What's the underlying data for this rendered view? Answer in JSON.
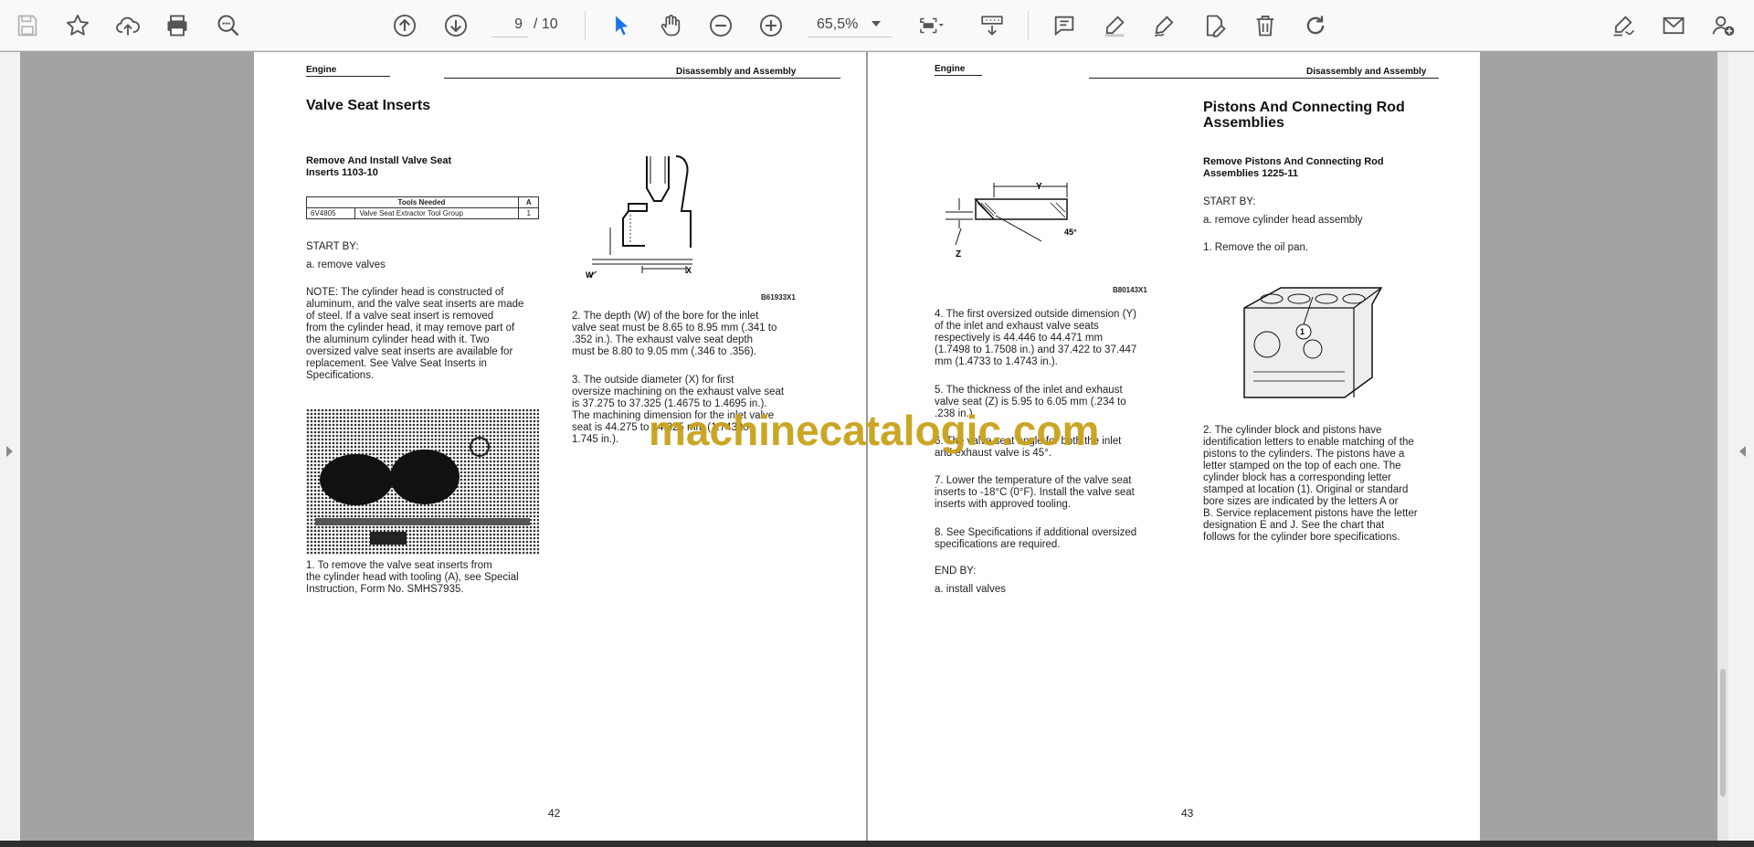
{
  "toolbar": {
    "current_page": "9",
    "total_pages": "/ 10",
    "zoom": "65,5%",
    "icons": [
      "save-icon",
      "bookmark-star-icon",
      "upload-cloud-icon",
      "print-icon",
      "zoom-search-icon",
      "page-up-icon",
      "page-down-icon",
      "select-cursor-icon",
      "hand-pan-icon",
      "zoom-out-icon",
      "zoom-in-icon",
      "fit-page-icon",
      "scroll-mode-icon",
      "comment-icon",
      "highlight-pen-icon",
      "draw-pen-icon",
      "edit-text-icon",
      "trash-icon",
      "rotate-icon",
      "sign-icon",
      "email-icon",
      "share-user-icon"
    ]
  },
  "page42": {
    "header_left": "Engine",
    "header_right": "Disassembly and Assembly",
    "title": "Valve Seat Inserts",
    "subtitle": "Remove And Install Valve Seat\nInserts     1103-10",
    "table": {
      "header": "Tools Needed",
      "col_a": "A",
      "part": "6V4805",
      "desc": "Valve Seat Extractor Tool Group",
      "qty": "1"
    },
    "start_by": "START BY:",
    "start_a": "a.  remove valves",
    "note": "NOTE:  The cylinder head is constructed of\naluminum, and the valve seat inserts are made\nof steel. If a valve seat insert is removed\nfrom the cylinder head, it may remove part of\nthe aluminum cylinder head with it. Two\noversized valve seat inserts are available for\nreplacement. See Valve Seat Inserts in\nSpecifications.",
    "step1": "1.  To remove the valve seat inserts from\nthe cylinder head with tooling (A), see Special\nInstruction, Form No. SMHS7935.",
    "fig_caption": "B61933X1",
    "step2": "2.  The depth (W) of the bore for the inlet\nvalve seat must be 8.65 to 8.95 mm (.341 to\n.352 in.). The exhaust valve seat depth\nmust be 8.80 to 9.05 mm (.346 to .356).",
    "step3": "3.  The outside diameter (X) for first\noversize machining on the exhaust valve seat\nis 37.275 to 37.325 (1.4675 to 1.4695 in.).\nThe machining dimension for the inlet valve\nseat is 44.275 to 44.325 mm (1.743 to\n1.745 in.).",
    "label_w": "W",
    "label_x": "X",
    "page_number": "42"
  },
  "page43": {
    "header_left": "Engine",
    "header_right": "Disassembly and Assembly",
    "fig_caption": "B80143X1",
    "label_y": "Y",
    "label_z": "Z",
    "label_angle": "45°",
    "step4": "4.  The first oversized outside dimension (Y)\nof the inlet and exhaust valve seats\nrespectively is 44.446 to 44.471 mm\n(1.7498 to 1.7508 in.) and 37.422 to 37.447\nmm (1.4733 to 1.4743 in.).",
    "step5": "5.  The thickness of the inlet and exhaust\nvalve seat (Z) is 5.95 to 6.05 mm (.234 to\n.238 in.).",
    "step6": "6.  The valve seat angle for both the inlet\nand exhaust valve is 45°.",
    "step7": "7.  Lower the temperature of the valve seat\ninserts to -18°C (0°F). Install the valve seat\ninserts with approved tooling.",
    "step8": "8.  See Specifications if additional oversized\nspecifications are required.",
    "end_by": "END BY:",
    "end_a": "a.  install valves",
    "title": "Pistons And Connecting Rod\nAssemblies",
    "subtitle": "Remove Pistons And Connecting Rod\nAssemblies     1225-11",
    "start_by": "START BY:",
    "start_a": "a.  remove cylinder head assembly",
    "r_step1": "1.  Remove the oil pan.",
    "block_label": "1",
    "r_step2": "2.  The cylinder block and pistons have\nidentification letters to enable matching of the\npistons to the cylinders. The pistons have a\nletter stamped on the top of each one. The\ncylinder block has a corresponding letter\nstamped at location (1). Original or standard\nbore sizes are indicated by the letters A or\nB. Service replacement pistons have the letter\ndesignation E and J. See the chart that\nfollows for the cylinder bore specifications.",
    "page_number": "43"
  },
  "watermark": "machinecatalogic.com"
}
